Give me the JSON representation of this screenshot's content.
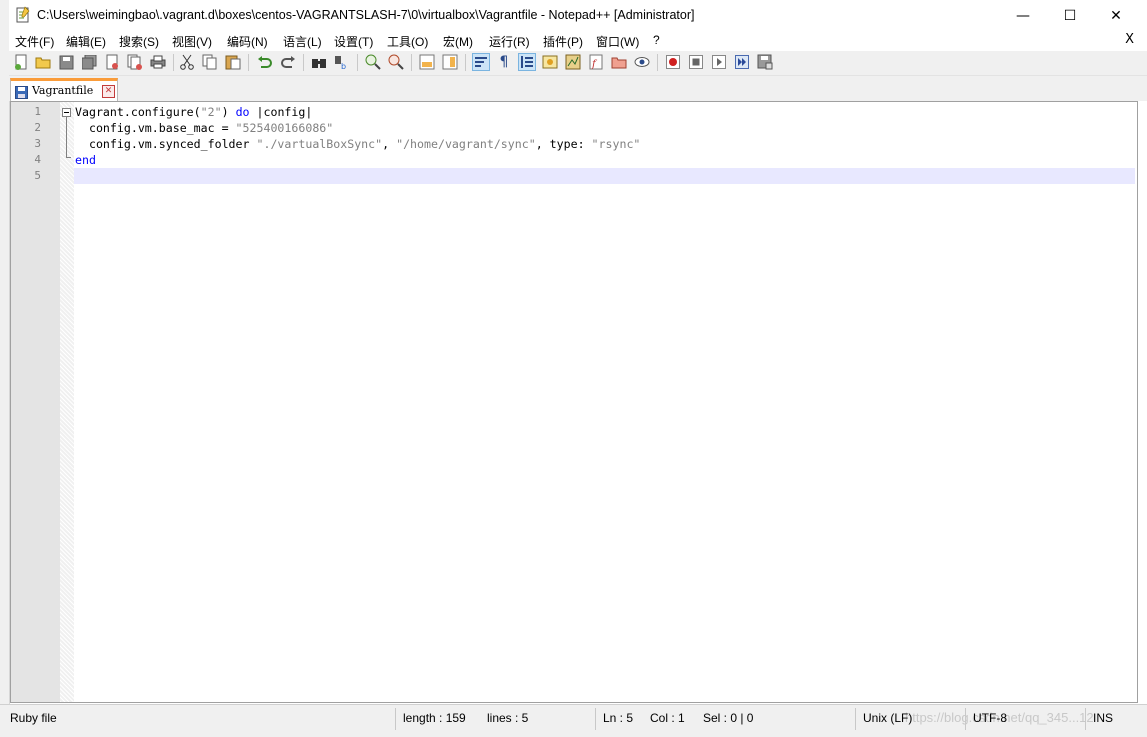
{
  "window": {
    "title": "C:\\Users\\weimingbao\\.vagrant.d\\boxes\\centos-VAGRANTSLASH-7\\0\\virtualbox\\Vagrantfile - Notepad++ [Administrator]",
    "minimize": "—",
    "maximize": "☐",
    "close": "✕"
  },
  "menu": {
    "items": [
      "文件(F)",
      "编辑(E)",
      "搜索(S)",
      "视图(V)",
      "编码(N)",
      "语言(L)",
      "设置(T)",
      "工具(O)",
      "宏(M)",
      "运行(R)",
      "插件(P)",
      "窗口(W)",
      "?"
    ],
    "close_doc": "X"
  },
  "tab": {
    "label": "Vagrantfile",
    "close": "✕"
  },
  "editor": {
    "line_numbers": [
      "1",
      "2",
      "3",
      "4",
      "5"
    ],
    "lines": [
      {
        "t1": "Vagrant.configure(",
        "t2": "\"2\"",
        "t3": ") ",
        "t4": "do",
        "t5": " |config|"
      },
      {
        "t1": "  config.vm.base_mac = ",
        "t2": "\"525400166086\""
      },
      {
        "t1": "  config.vm.synced_folder ",
        "t2": "\"./vartualBoxSync\"",
        "t3": ", ",
        "t4": "\"/home/vagrant/sync\"",
        "t5": ", type: ",
        "t6": "\"rsync\""
      },
      {
        "t1": "end"
      },
      {
        "t1": ""
      }
    ],
    "current_line": 5
  },
  "status": {
    "language": "Ruby file",
    "length": "length : 159",
    "lines": "lines : 5",
    "ln": "Ln : 5",
    "col": "Col : 1",
    "sel": "Sel : 0 | 0",
    "eol": "Unix (LF)",
    "encoding": "UTF-8",
    "mode": "INS",
    "watermark": "https://blog.csdn.net/qq_345...12"
  },
  "colors": {
    "keyword": "#0000ff",
    "string": "#808080",
    "tab_accent": "#fa9c3a",
    "current_line": "#e8e8ff"
  }
}
